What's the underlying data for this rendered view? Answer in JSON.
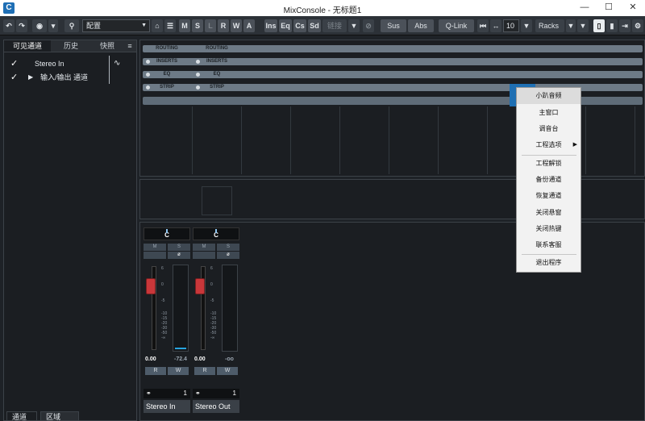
{
  "window": {
    "title": "MixConsole - 无标题1",
    "minimize": "—",
    "maximize": "☐",
    "close": "✕"
  },
  "toolbar": {
    "undo": "↶",
    "redo": "↷",
    "camera": "◉",
    "search": "⚲",
    "config": "配置",
    "buttons": [
      "M",
      "S",
      "L",
      "R",
      "W",
      "A"
    ],
    "ins": "Ins",
    "eq": "Eq",
    "cs": "Cs",
    "sd": "Sd",
    "link": "链接",
    "sus": "Sus",
    "abs": "Abs",
    "qlink": "Q-Link",
    "channels": "10",
    "racks": "Racks"
  },
  "left": {
    "tabs": [
      "可见通道",
      "历史",
      "快照"
    ],
    "menu_icon": "≡",
    "rows": [
      {
        "check": "✓",
        "label": "Stereo In"
      },
      {
        "check": "✓",
        "label": "输入/输出 通道"
      }
    ],
    "bottom_tabs": [
      "通道",
      "区域"
    ]
  },
  "racks": [
    {
      "label": "ROUTING",
      "label2": "ROUTING"
    },
    {
      "label": "INSERTS",
      "label2": "INSERTS"
    },
    {
      "label": "EQ",
      "label2": "EQ"
    },
    {
      "label": "STRIP",
      "label2": "STRIP"
    }
  ],
  "strips": [
    {
      "pan": "C",
      "mute": "M",
      "solo": "S",
      "phase": "ø",
      "volume": "0.00",
      "peak": "-72.4",
      "read": "R",
      "write": "W",
      "link": "1",
      "name": "Stereo In"
    },
    {
      "pan": "C",
      "mute": "M",
      "solo": "S",
      "phase": "ø",
      "volume": "0.00",
      "peak": "-oo",
      "read": "R",
      "write": "W",
      "link": "1",
      "name": "Stereo Out"
    }
  ],
  "scale": [
    "6",
    "0",
    "-5",
    "-10",
    "-15",
    "-20",
    "-30",
    "-50",
    "-∞"
  ],
  "meter_scale": [
    "0",
    "3",
    "6",
    "12",
    "18",
    "24",
    "30",
    "36",
    "40",
    "50",
    "∞"
  ],
  "context_menu": [
    "小趴音频",
    "主窗口",
    "调音台",
    "工程选项",
    "工程解锁",
    "备份通道",
    "恢复通道",
    "关闭悬窗",
    "关闭热键",
    "联系客服",
    "退出程序"
  ],
  "colors": {
    "accent": "#1e6fb3",
    "fader": "#c9373a",
    "panel": "#1b1e22"
  }
}
